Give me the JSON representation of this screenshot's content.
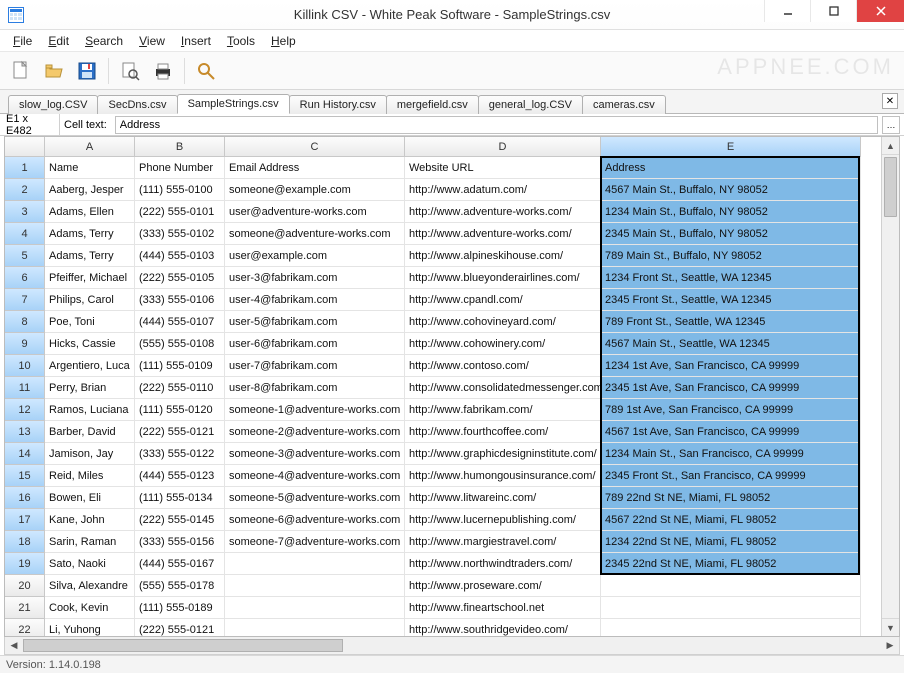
{
  "window": {
    "title": "Killink CSV - White Peak Software - SampleStrings.csv",
    "watermark": "APPNEE.COM"
  },
  "menu": [
    "File",
    "Edit",
    "Search",
    "View",
    "Insert",
    "Tools",
    "Help"
  ],
  "tabs": {
    "items": [
      "slow_log.CSV",
      "SecDns.csv",
      "SampleStrings.csv",
      "Run History.csv",
      "mergefield.csv",
      "general_log.CSV",
      "cameras.csv"
    ],
    "active_index": 2
  },
  "refbar": {
    "range": "E1 x E482",
    "label": "Cell text:",
    "value": "Address"
  },
  "columns": [
    "A",
    "B",
    "C",
    "D",
    "E"
  ],
  "selected_col_index": 4,
  "rows": [
    {
      "n": 1,
      "A": "Name",
      "B": "Phone Number",
      "C": "Email Address",
      "D": "Website URL",
      "E": "Address"
    },
    {
      "n": 2,
      "A": "Aaberg, Jesper",
      "B": "(111) 555-0100",
      "C": "someone@example.com",
      "D": "http://www.adatum.com/",
      "E": "4567 Main St., Buffalo, NY 98052"
    },
    {
      "n": 3,
      "A": "Adams, Ellen",
      "B": "(222) 555-0101",
      "C": "user@adventure-works.com",
      "D": "http://www.adventure-works.com/",
      "E": "1234 Main St., Buffalo, NY 98052"
    },
    {
      "n": 4,
      "A": "Adams, Terry",
      "B": "(333) 555-0102",
      "C": "someone@adventure-works.com",
      "D": "http://www.adventure-works.com/",
      "E": "2345 Main St., Buffalo, NY 98052"
    },
    {
      "n": 5,
      "A": "Adams, Terry",
      "B": "(444) 555-0103",
      "C": "user@example.com",
      "D": "http://www.alpineskihouse.com/",
      "E": "789 Main St., Buffalo, NY 98052"
    },
    {
      "n": 6,
      "A": "Pfeiffer, Michael",
      "B": "(222) 555-0105",
      "C": "user-3@fabrikam.com",
      "D": "http://www.blueyonderairlines.com/",
      "E": "1234 Front St., Seattle, WA 12345"
    },
    {
      "n": 7,
      "A": "Philips, Carol",
      "B": "(333) 555-0106",
      "C": "user-4@fabrikam.com",
      "D": "http://www.cpandl.com/",
      "E": "2345 Front St., Seattle, WA 12345"
    },
    {
      "n": 8,
      "A": "Poe, Toni",
      "B": "(444) 555-0107",
      "C": "user-5@fabrikam.com",
      "D": "http://www.cohovineyard.com/",
      "E": "789 Front St., Seattle, WA 12345"
    },
    {
      "n": 9,
      "A": "Hicks, Cassie",
      "B": "(555) 555-0108",
      "C": "user-6@fabrikam.com",
      "D": "http://www.cohowinery.com/",
      "E": "4567 Main St., Seattle, WA 12345"
    },
    {
      "n": 10,
      "A": "Argentiero, Luca",
      "B": "(111) 555-0109",
      "C": "user-7@fabrikam.com",
      "D": "http://www.contoso.com/",
      "E": "1234 1st Ave, San Francisco, CA 99999"
    },
    {
      "n": 11,
      "A": "Perry, Brian",
      "B": "(222) 555-0110",
      "C": "user-8@fabrikam.com",
      "D": "http://www.consolidatedmessenger.com/",
      "E": "2345 1st Ave, San Francisco, CA 99999"
    },
    {
      "n": 12,
      "A": "Ramos, Luciana",
      "B": "(111) 555-0120",
      "C": "someone-1@adventure-works.com",
      "D": "http://www.fabrikam.com/",
      "E": "789 1st Ave, San Francisco, CA 99999"
    },
    {
      "n": 13,
      "A": "Barber, David",
      "B": "(222) 555-0121",
      "C": "someone-2@adventure-works.com",
      "D": "http://www.fourthcoffee.com/",
      "E": "4567 1st Ave, San Francisco, CA 99999"
    },
    {
      "n": 14,
      "A": "Jamison, Jay",
      "B": "(333) 555-0122",
      "C": "someone-3@adventure-works.com",
      "D": "http://www.graphicdesigninstitute.com/",
      "E": "1234 Main St., San Francisco, CA 99999"
    },
    {
      "n": 15,
      "A": "Reid, Miles",
      "B": "(444) 555-0123",
      "C": "someone-4@adventure-works.com",
      "D": "http://www.humongousinsurance.com/",
      "E": "2345 Front St., San Francisco, CA 99999"
    },
    {
      "n": 16,
      "A": "Bowen, Eli",
      "B": "(111) 555-0134",
      "C": "someone-5@adventure-works.com",
      "D": "http://www.litwareinc.com/",
      "E": "789 22nd St NE, Miami, FL 98052"
    },
    {
      "n": 17,
      "A": "Kane, John",
      "B": "(222) 555-0145",
      "C": "someone-6@adventure-works.com",
      "D": "http://www.lucernepublishing.com/",
      "E": "4567 22nd St NE, Miami, FL 98052"
    },
    {
      "n": 18,
      "A": "Sarin, Raman",
      "B": "(333) 555-0156",
      "C": "someone-7@adventure-works.com",
      "D": "http://www.margiestravel.com/",
      "E": "1234 22nd St NE, Miami, FL 98052"
    },
    {
      "n": 19,
      "A": "Sato, Naoki",
      "B": "(444) 555-0167",
      "C": "",
      "D": "http://www.northwindtraders.com/",
      "E": "2345 22nd St NE, Miami, FL 98052"
    },
    {
      "n": 20,
      "A": "Silva, Alexandre",
      "B": "(555) 555-0178",
      "C": "",
      "D": "http://www.proseware.com/",
      "E": ""
    },
    {
      "n": 21,
      "A": "Cook, Kevin",
      "B": "(111) 555-0189",
      "C": "",
      "D": "http://www.fineartschool.net",
      "E": ""
    },
    {
      "n": 22,
      "A": "Li, Yuhong",
      "B": "(222) 555-0121",
      "C": "",
      "D": "http://www.southridgevideo.com/",
      "E": ""
    }
  ],
  "status": {
    "version_label": "Version:",
    "version": "1.14.0.198"
  }
}
